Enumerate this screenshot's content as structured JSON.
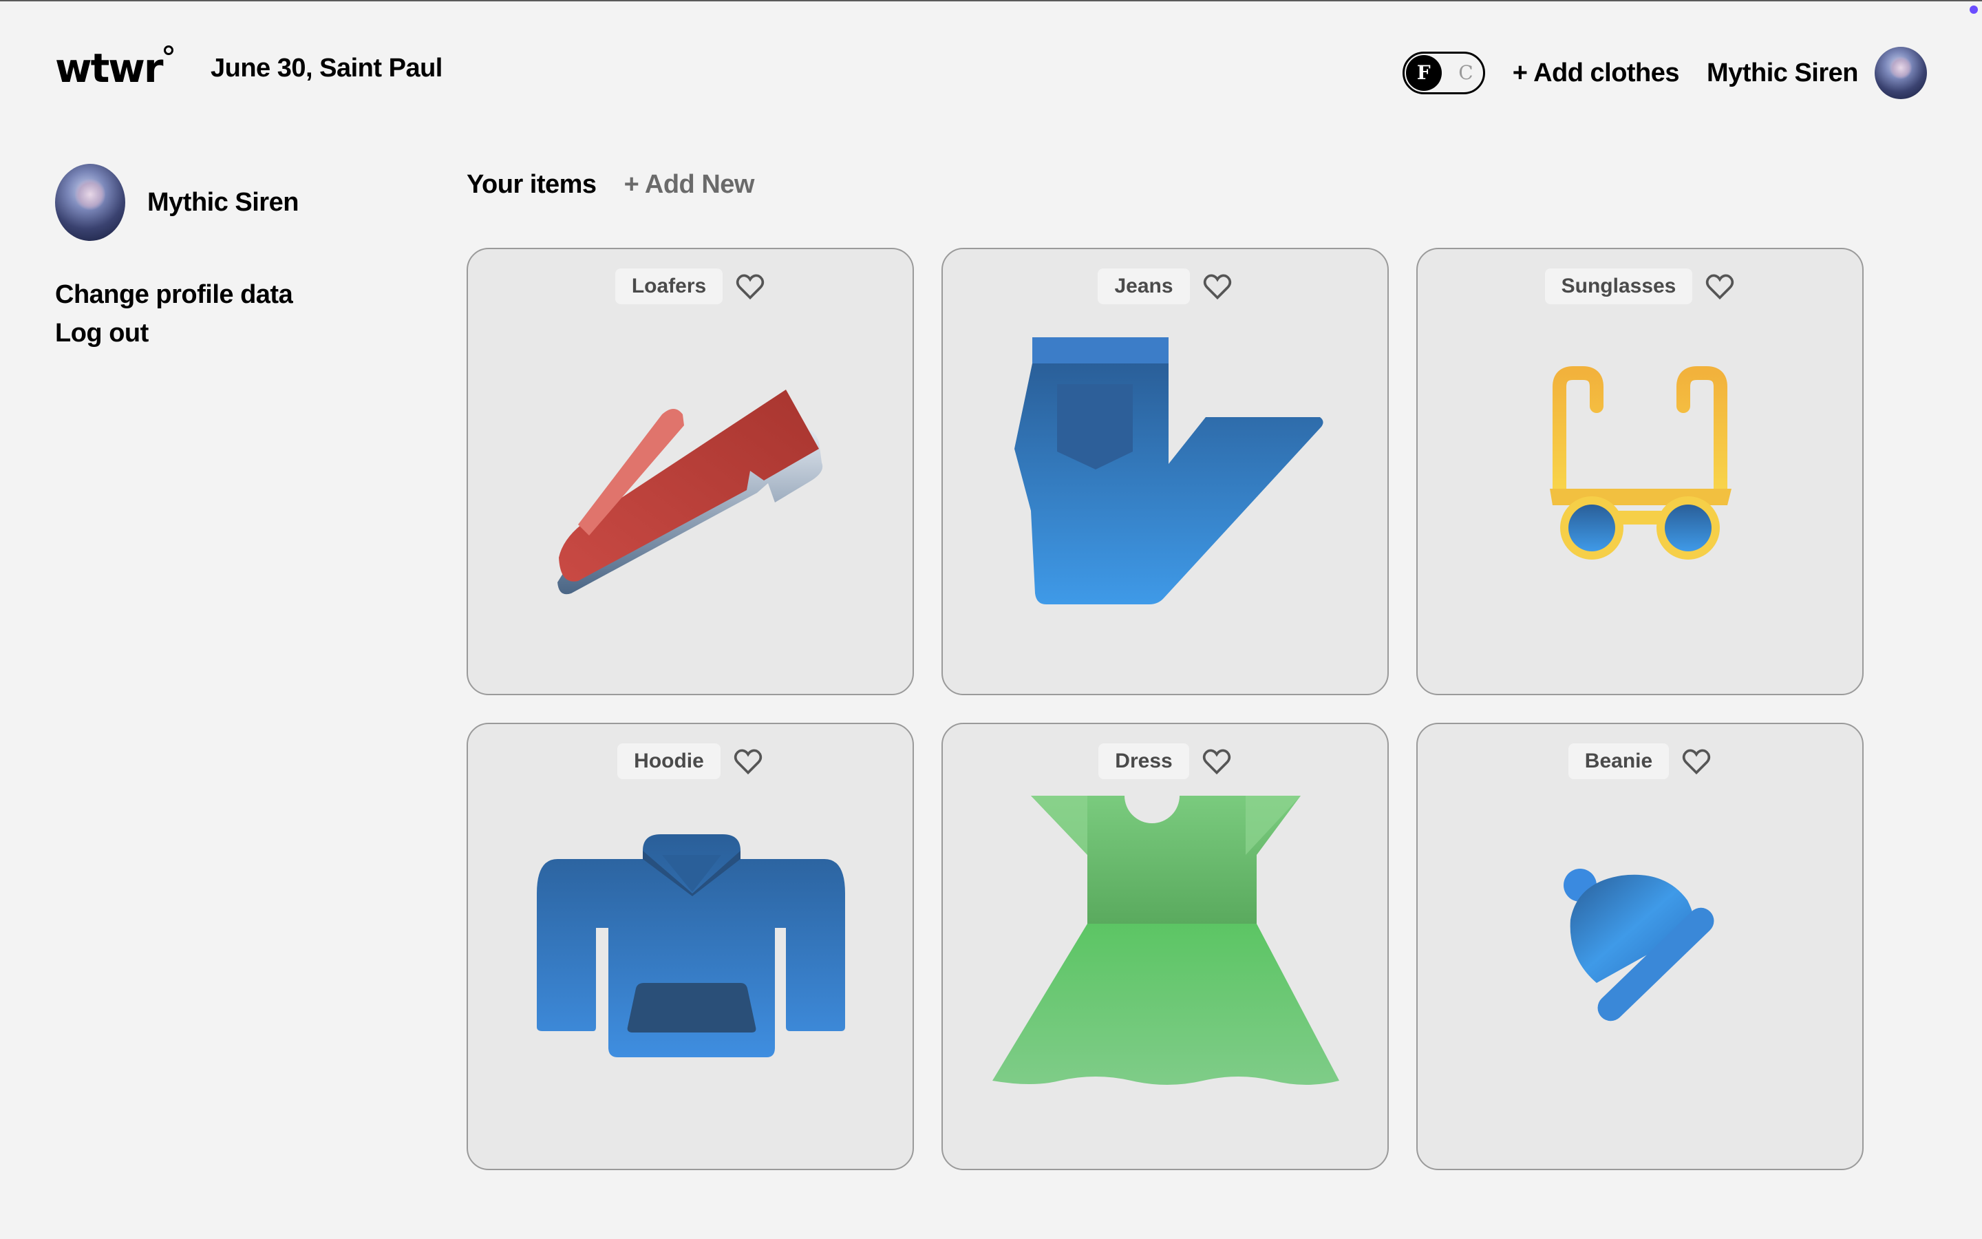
{
  "header": {
    "logo": "wtwr",
    "date_location": "June 30, Saint Paul",
    "toggle": {
      "left": "F",
      "right": "C",
      "active": "F"
    },
    "add_clothes": "+ Add clothes",
    "user_name": "Mythic Siren"
  },
  "sidebar": {
    "user_name": "Mythic Siren",
    "links": [
      "Change profile data",
      "Log out"
    ]
  },
  "main": {
    "title": "Your items",
    "add_new": "+ Add New",
    "items": [
      {
        "label": "Loafers",
        "icon": "loafer-icon",
        "liked": false
      },
      {
        "label": "Jeans",
        "icon": "jeans-icon",
        "liked": false
      },
      {
        "label": "Sunglasses",
        "icon": "sunglasses-icon",
        "liked": false
      },
      {
        "label": "Hoodie",
        "icon": "hoodie-icon",
        "liked": false
      },
      {
        "label": "Dress",
        "icon": "dress-icon",
        "liked": false
      },
      {
        "label": "Beanie",
        "icon": "beanie-icon",
        "liked": false
      }
    ]
  },
  "colors": {
    "background": "#f3f3f3",
    "card": "#e8e8e8",
    "accent_dot": "#6b4dff"
  }
}
